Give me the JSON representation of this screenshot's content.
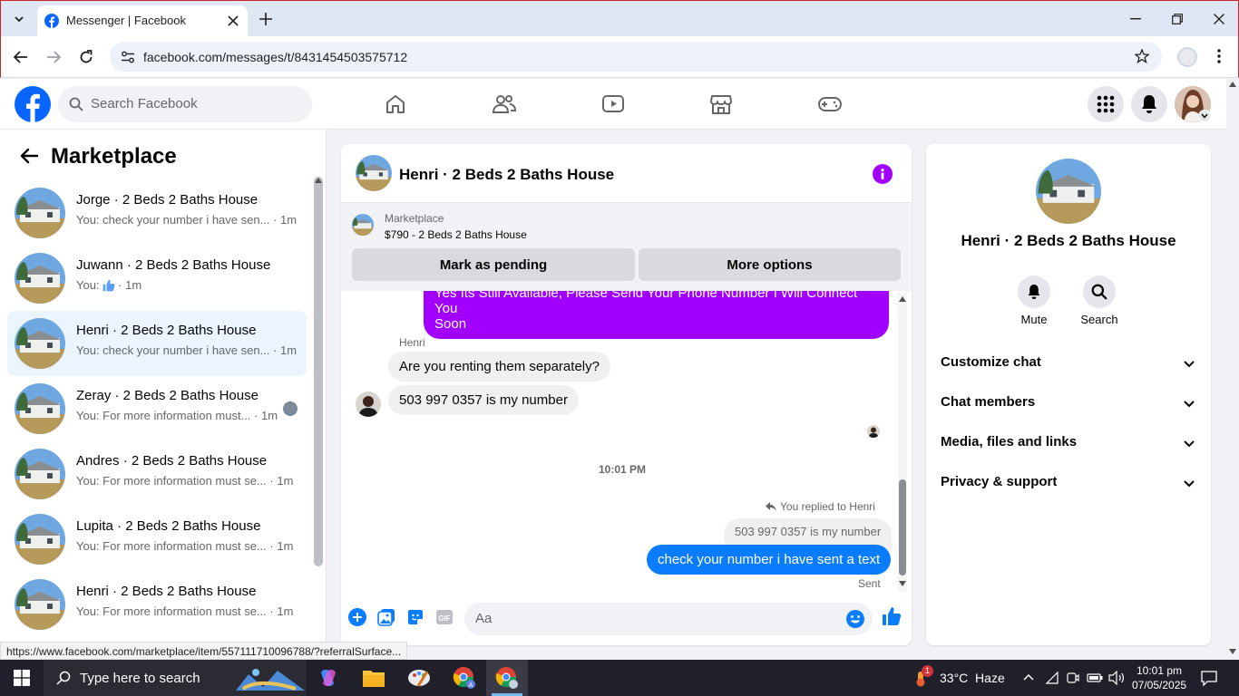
{
  "browser": {
    "tab_title": "Messenger | Facebook",
    "url": "facebook.com/messages/t/8431454503575712",
    "status_url": "https://www.facebook.com/marketplace/item/557111710096788/?referralSurface..."
  },
  "fb": {
    "search_placeholder": "Search Facebook",
    "brand_color": "#0866ff"
  },
  "left": {
    "heading": "Marketplace",
    "conversations": [
      {
        "name": "Jorge · 2 Beds 2 Baths House",
        "snippet": "You: check your number i have sen...",
        "time": "1m"
      },
      {
        "name": "Juwann · 2 Beds 2 Baths House",
        "snippet": "You:",
        "time": "1m"
      },
      {
        "name": "Henri · 2 Beds 2 Baths House",
        "snippet": "You: check your number i have sen...",
        "time": "1m"
      },
      {
        "name": "Zeray · 2 Beds 2 Baths House",
        "snippet": "You: For more information must...",
        "time": "1m"
      },
      {
        "name": "Andres · 2 Beds 2 Baths House",
        "snippet": "You: For more information must se...",
        "time": "1m"
      },
      {
        "name": "Lupita · 2 Beds 2 Baths House",
        "snippet": "You: For more information must se...",
        "time": "1m"
      },
      {
        "name": "Henri · 2 Beds 2 Baths House",
        "snippet": "You: For more information must se...",
        "time": "1m"
      }
    ]
  },
  "chat": {
    "title": "Henri · 2 Beds 2 Baths House",
    "marketplace_label": "Marketplace",
    "listing": "$790 - 2 Beds 2 Baths House",
    "mark_pending": "Mark as pending",
    "more_options": "More options",
    "msg_out_top_line1": "Yes Its Still Available, Please Send Your Phone Number  I Will Connect You",
    "msg_out_top_line2": "Soon",
    "sender_name": "Henri",
    "msg_in_1": "Are you renting them separately?",
    "msg_in_2": "503 997 0357 is my number",
    "timestamp": "10:01 PM",
    "replied_to": "You replied to Henri",
    "quoted": "503 997 0357 is my number",
    "msg_out_last": "check your number i have sent a text",
    "sent_label": "Sent",
    "composer_placeholder": "Aa",
    "purple": "#a100ff",
    "blue": "#0a7cff"
  },
  "right": {
    "name": "Henri · 2 Beds 2 Baths House",
    "mute_label": "Mute",
    "search_label": "Search",
    "sections": [
      "Customize chat",
      "Chat members",
      "Media, files and links",
      "Privacy & support"
    ]
  },
  "taskbar": {
    "search_placeholder": "Type here to search",
    "weather": "33°C  Haze",
    "time": "10:01 pm",
    "date": "07/05/2025",
    "badge": "1"
  }
}
